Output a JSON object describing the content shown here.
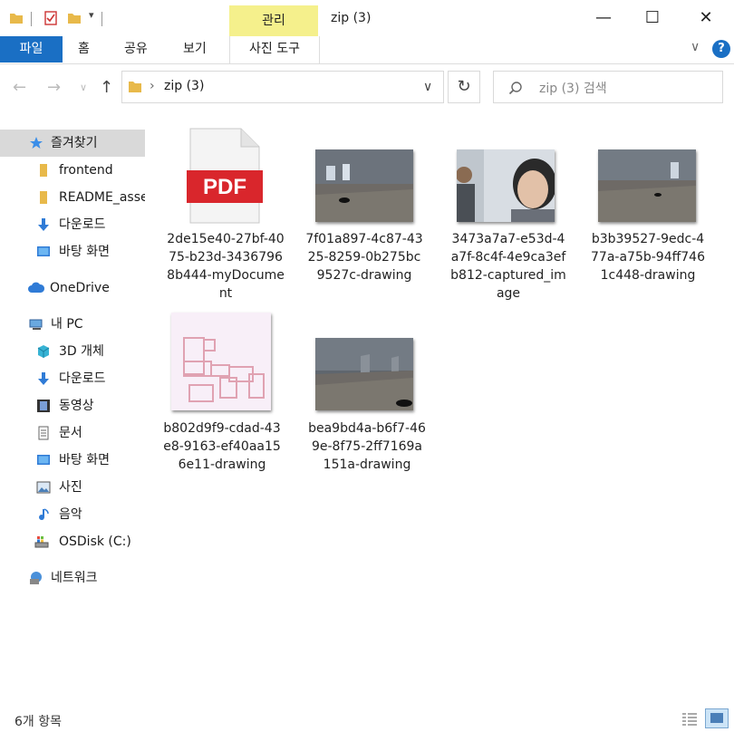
{
  "title_bar": {
    "context_tab_label": "관리",
    "window_title": "zip (3)",
    "minimize_glyph": "—",
    "maximize_glyph": "☐",
    "close_glyph": "✕"
  },
  "ribbon": {
    "file_tab": "파일",
    "tabs": [
      "홈",
      "공유",
      "보기"
    ],
    "context_subtab": "사진 도구",
    "expand_glyph": "∨",
    "help_glyph": "?"
  },
  "address_bar": {
    "path": "zip (3)",
    "separator": "›",
    "dropdown_glyph": "∨",
    "refresh_glyph": "↻",
    "search_placeholder": "zip (3) 검색"
  },
  "sidebar": {
    "items": [
      {
        "label": "즐겨찾기",
        "icon": "star-icon"
      },
      {
        "label": "frontend",
        "icon": "folder-icon"
      },
      {
        "label": "README_asse",
        "icon": "folder-icon"
      },
      {
        "label": "다운로드",
        "icon": "download-icon"
      },
      {
        "label": "바탕 화면",
        "icon": "desktop-icon"
      },
      {
        "label": "OneDrive",
        "icon": "cloud-icon"
      },
      {
        "label": "내 PC",
        "icon": "pc-icon"
      },
      {
        "label": "3D 개체",
        "icon": "cube-icon"
      },
      {
        "label": "다운로드",
        "icon": "download-icon"
      },
      {
        "label": "동영상",
        "icon": "video-icon"
      },
      {
        "label": "문서",
        "icon": "document-icon"
      },
      {
        "label": "바탕 화면",
        "icon": "desktop-icon"
      },
      {
        "label": "사진",
        "icon": "picture-icon"
      },
      {
        "label": "음악",
        "icon": "music-icon"
      },
      {
        "label": "OSDisk (C:)",
        "icon": "drive-icon"
      },
      {
        "label": "네트워크",
        "icon": "network-icon"
      }
    ]
  },
  "files": [
    {
      "name": "2de15e40-27bf-4075-b23d-34367968b444-myDocument",
      "type": "pdf",
      "badge": "PDF"
    },
    {
      "name": "7f01a897-4c87-4325-8259-0b275bc9527c-drawing",
      "type": "scene"
    },
    {
      "name": "3473a7a7-e53d-4a7f-8c4f-4e9ca3efb812-captured_image",
      "type": "photo"
    },
    {
      "name": "b3b39527-9edc-477a-a75b-94ff7461c448-drawing",
      "type": "scene"
    },
    {
      "name": "b802d9f9-cdad-43e8-9163-ef40aa156e11-drawing",
      "type": "floorplan"
    },
    {
      "name": "bea9bd4a-b6f7-469e-8f75-2ff7169a151a-drawing",
      "type": "scene"
    }
  ],
  "status_bar": {
    "item_count": "6개 항목"
  },
  "colors": {
    "accent": "#1a6fc4",
    "context_tab": "#f5f08c",
    "selection": "#d9d9d9"
  }
}
